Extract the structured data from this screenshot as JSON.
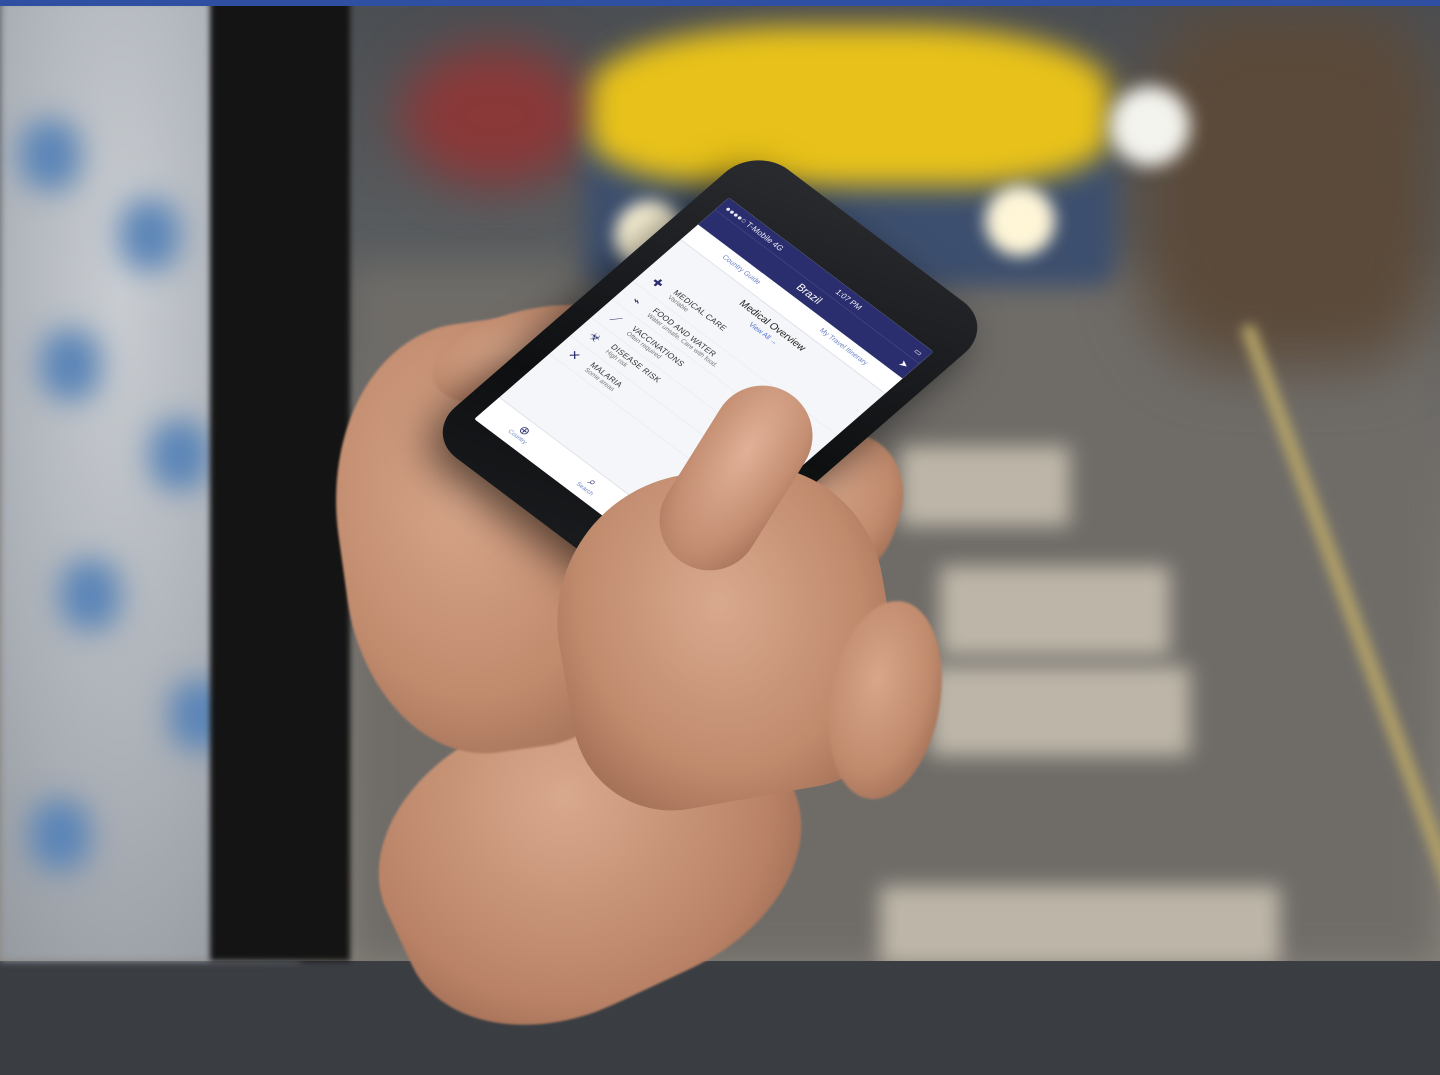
{
  "phone": {
    "status": {
      "carrier": "●●●●○ T-Mobile  4G",
      "time": "1:07 PM"
    },
    "nav_title": "Brazil",
    "tabs": [
      "Country Guide",
      "My Travel Itinerary"
    ],
    "section_title": "Medical Overview",
    "view_all": "View All →",
    "rows": [
      {
        "icon": "medical-bag-icon",
        "glyph": "✚",
        "title": "MEDICAL CARE",
        "subtitle": "Variable"
      },
      {
        "icon": "water-tap-icon",
        "glyph": "⌁",
        "title": "FOOD AND WATER",
        "subtitle": "Water unsafe. Care with food."
      },
      {
        "icon": "syringe-icon",
        "glyph": "⟋",
        "title": "VACCINATIONS",
        "subtitle": "Often required"
      },
      {
        "icon": "virus-icon",
        "glyph": "☣",
        "title": "DISEASE RISK",
        "subtitle": "High risk"
      },
      {
        "icon": "mosquito-icon",
        "glyph": "✕",
        "title": "MALARIA",
        "subtitle": "Some areas"
      }
    ],
    "tabbar": [
      {
        "icon": "globe-icon",
        "glyph": "⊕",
        "label": "Country"
      },
      {
        "icon": "search-icon",
        "glyph": "⌕",
        "label": "Search"
      }
    ]
  },
  "colors": {
    "app_navy": "#2b2e6e",
    "link_blue": "#4e6fd0",
    "top_bar": "#2f4fa2"
  }
}
